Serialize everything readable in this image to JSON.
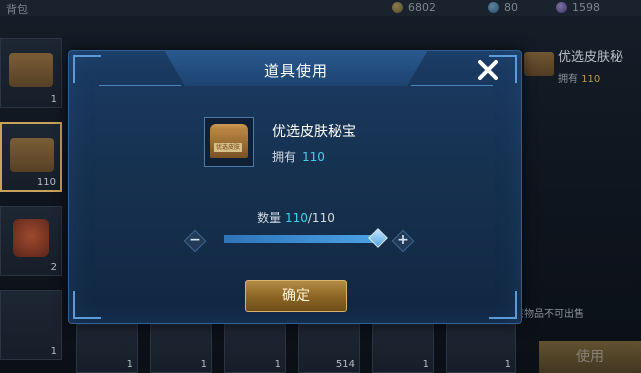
{
  "dialog": {
    "title": "道具使用",
    "item_name": "优选皮肤秘宝",
    "item_tag": "优选皮肤",
    "own_label": "拥有",
    "own_count": "110",
    "qty_label": "数量",
    "qty_current": "110",
    "qty_total": "/110",
    "slider_fraction": 1.0,
    "confirm_label": "确定"
  },
  "background": {
    "topbar": {
      "tab_label": "背包",
      "coins": "6802",
      "gems": "80",
      "vouchers": "1598"
    },
    "slots": [
      {
        "count": "1"
      },
      {
        "count": "110"
      },
      {
        "count": "2"
      },
      {
        "count": "1"
      },
      {
        "count": "1"
      },
      {
        "count": "1"
      },
      {
        "count": "1"
      },
      {
        "count": "514"
      },
      {
        "count": "1"
      },
      {
        "count": "1"
      }
    ],
    "side_panel": {
      "item_name": "优选皮肤秘",
      "own_label": "拥有",
      "own_count": "110",
      "note": "该物品不可出售",
      "use_button": "使用"
    }
  },
  "colors": {
    "accent_cyan": "#3fd3e8",
    "dialog_blue": "#1b3b63",
    "gold_button": "#b58c46"
  },
  "icons": [
    "close-icon",
    "minus-icon",
    "plus-icon",
    "chest-icon"
  ]
}
